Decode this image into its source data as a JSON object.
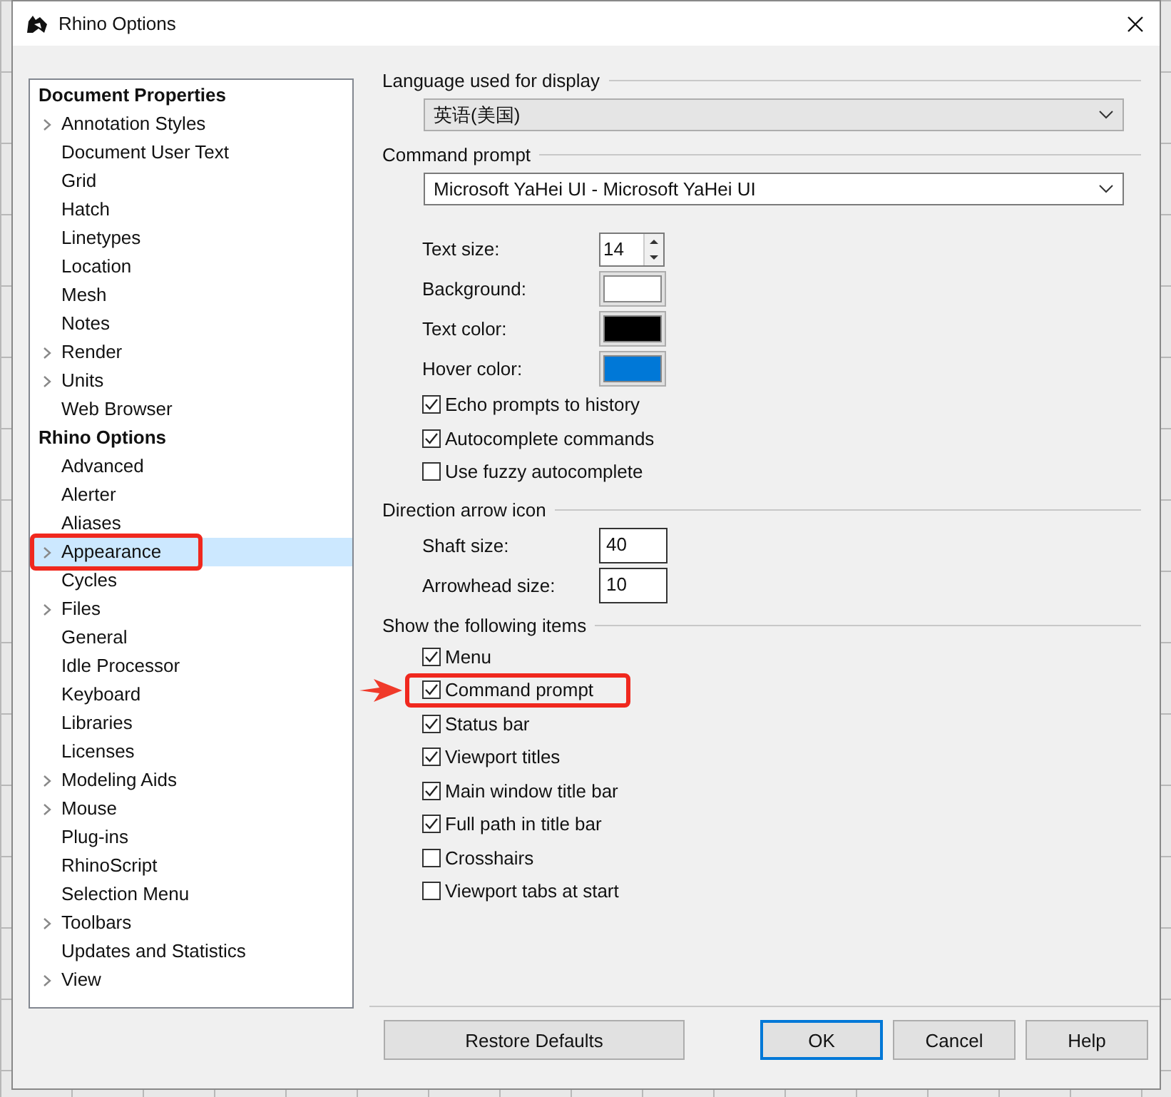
{
  "window": {
    "title": "Rhino Options"
  },
  "tree": [
    {
      "label": "Document Properties",
      "children": [
        {
          "label": "Annotation Styles",
          "expandable": true,
          "selected": false,
          "highlighted": false
        },
        {
          "label": "Document User Text",
          "expandable": false,
          "selected": false,
          "highlighted": false
        },
        {
          "label": "Grid",
          "expandable": false,
          "selected": false,
          "highlighted": false
        },
        {
          "label": "Hatch",
          "expandable": false,
          "selected": false,
          "highlighted": false
        },
        {
          "label": "Linetypes",
          "expandable": false,
          "selected": false,
          "highlighted": false
        },
        {
          "label": "Location",
          "expandable": false,
          "selected": false,
          "highlighted": false
        },
        {
          "label": "Mesh",
          "expandable": false,
          "selected": false,
          "highlighted": false
        },
        {
          "label": "Notes",
          "expandable": false,
          "selected": false,
          "highlighted": false
        },
        {
          "label": "Render",
          "expandable": true,
          "selected": false,
          "highlighted": false
        },
        {
          "label": "Units",
          "expandable": true,
          "selected": false,
          "highlighted": false
        },
        {
          "label": "Web Browser",
          "expandable": false,
          "selected": false,
          "highlighted": false
        }
      ]
    },
    {
      "label": "Rhino Options",
      "children": [
        {
          "label": "Advanced",
          "expandable": false,
          "selected": false,
          "highlighted": false
        },
        {
          "label": "Alerter",
          "expandable": false,
          "selected": false,
          "highlighted": false
        },
        {
          "label": "Aliases",
          "expandable": false,
          "selected": false,
          "highlighted": false
        },
        {
          "label": "Appearance",
          "expandable": true,
          "selected": true,
          "highlighted": true
        },
        {
          "label": "Cycles",
          "expandable": false,
          "selected": false,
          "highlighted": false
        },
        {
          "label": "Files",
          "expandable": true,
          "selected": false,
          "highlighted": false
        },
        {
          "label": "General",
          "expandable": false,
          "selected": false,
          "highlighted": false
        },
        {
          "label": "Idle Processor",
          "expandable": false,
          "selected": false,
          "highlighted": false
        },
        {
          "label": "Keyboard",
          "expandable": false,
          "selected": false,
          "highlighted": false
        },
        {
          "label": "Libraries",
          "expandable": false,
          "selected": false,
          "highlighted": false
        },
        {
          "label": "Licenses",
          "expandable": false,
          "selected": false,
          "highlighted": false
        },
        {
          "label": "Modeling Aids",
          "expandable": true,
          "selected": false,
          "highlighted": false
        },
        {
          "label": "Mouse",
          "expandable": true,
          "selected": false,
          "highlighted": false
        },
        {
          "label": "Plug-ins",
          "expandable": false,
          "selected": false,
          "highlighted": false
        },
        {
          "label": "RhinoScript",
          "expandable": false,
          "selected": false,
          "highlighted": false
        },
        {
          "label": "Selection Menu",
          "expandable": false,
          "selected": false,
          "highlighted": false
        },
        {
          "label": "Toolbars",
          "expandable": true,
          "selected": false,
          "highlighted": false
        },
        {
          "label": "Updates and Statistics",
          "expandable": false,
          "selected": false,
          "highlighted": false
        },
        {
          "label": "View",
          "expandable": true,
          "selected": false,
          "highlighted": false
        }
      ]
    }
  ],
  "language": {
    "heading": "Language used for display",
    "value": "英语(美国)"
  },
  "command_prompt": {
    "heading": "Command prompt",
    "font": "Microsoft YaHei UI - Microsoft YaHei UI",
    "settings": [
      {
        "kind": "spinner",
        "label": "Text size:",
        "value": "14"
      },
      {
        "kind": "color",
        "label": "Background:",
        "color": "#ffffff"
      },
      {
        "kind": "color",
        "label": "Text color:",
        "color": "#000000"
      },
      {
        "kind": "color",
        "label": "Hover color:",
        "color": "#0078d7"
      }
    ],
    "options": [
      {
        "label": "Echo prompts to history",
        "checked": true
      },
      {
        "label": "Autocomplete commands",
        "checked": true
      },
      {
        "label": "Use fuzzy autocomplete",
        "checked": false
      }
    ]
  },
  "direction_arrow": {
    "heading": "Direction arrow icon",
    "fields": [
      {
        "label": "Shaft size:",
        "value": "40"
      },
      {
        "label": "Arrowhead size:",
        "value": "10"
      }
    ]
  },
  "show_items": {
    "heading": "Show the following items",
    "items": [
      {
        "label": "Menu",
        "checked": true,
        "highlighted": false
      },
      {
        "label": "Command prompt",
        "checked": true,
        "highlighted": true
      },
      {
        "label": "Status bar",
        "checked": true,
        "highlighted": false
      },
      {
        "label": "Viewport titles",
        "checked": true,
        "highlighted": false
      },
      {
        "label": "Main window title bar",
        "checked": true,
        "highlighted": false
      },
      {
        "label": "Full path in title bar",
        "checked": true,
        "highlighted": false
      },
      {
        "label": "Crosshairs",
        "checked": false,
        "highlighted": false
      },
      {
        "label": "Viewport tabs at start",
        "checked": false,
        "highlighted": false
      }
    ]
  },
  "buttons": [
    {
      "label": "Restore Defaults",
      "kind": "left"
    },
    {
      "label": "OK",
      "kind": "default"
    },
    {
      "label": "Cancel",
      "kind": "normal"
    },
    {
      "label": "Help",
      "kind": "normal"
    }
  ]
}
